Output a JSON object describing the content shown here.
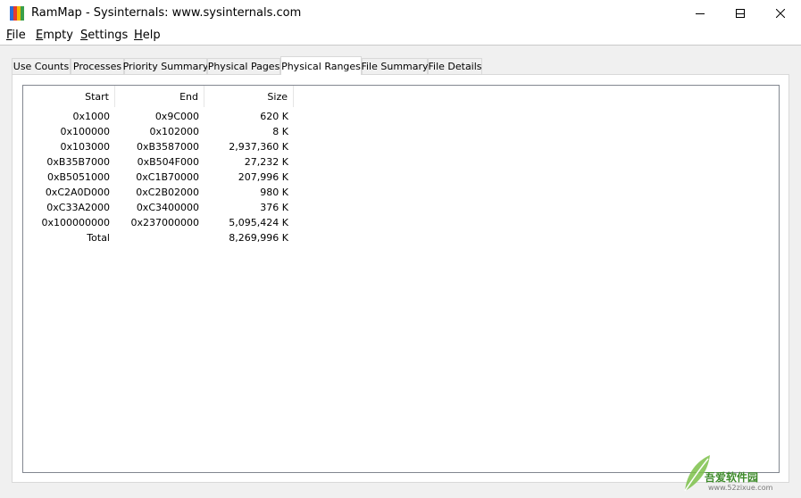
{
  "window": {
    "title": "RamMap - Sysinternals: www.sysinternals.com",
    "icon": "rammap-app-icon",
    "icon_colors": [
      "#2b6cd6",
      "#e63b2e",
      "#f5b800",
      "#3aa04a"
    ]
  },
  "menu": {
    "items": [
      {
        "first": "F",
        "rest": "ile"
      },
      {
        "first": "E",
        "rest": "mpty"
      },
      {
        "first": "S",
        "rest": "ettings"
      },
      {
        "first": "H",
        "rest": "elp"
      }
    ]
  },
  "tabs": [
    {
      "label": "Use Counts"
    },
    {
      "label": "Processes"
    },
    {
      "label": "Priority Summary"
    },
    {
      "label": "Physical Pages"
    },
    {
      "label": "Physical Ranges",
      "active": true
    },
    {
      "label": "File Summary"
    },
    {
      "label": "File Details"
    }
  ],
  "table": {
    "columns": [
      "Start",
      "End",
      "Size"
    ],
    "rows": [
      [
        "0x1000",
        "0x9C000",
        "620 K"
      ],
      [
        "0x100000",
        "0x102000",
        "8 K"
      ],
      [
        "0x103000",
        "0xB3587000",
        "2,937,360 K"
      ],
      [
        "0xB35B7000",
        "0xB504F000",
        "27,232 K"
      ],
      [
        "0xB5051000",
        "0xC1B70000",
        "207,996 K"
      ],
      [
        "0xC2A0D000",
        "0xC2B02000",
        "980 K"
      ],
      [
        "0xC33A2000",
        "0xC3400000",
        "376 K"
      ],
      [
        "0x100000000",
        "0x237000000",
        "5,095,424 K"
      ],
      [
        "Total",
        "",
        "8,269,996 K"
      ]
    ]
  },
  "watermark": {
    "text": "吾爱软件园",
    "url": "www.52zixue.com"
  }
}
